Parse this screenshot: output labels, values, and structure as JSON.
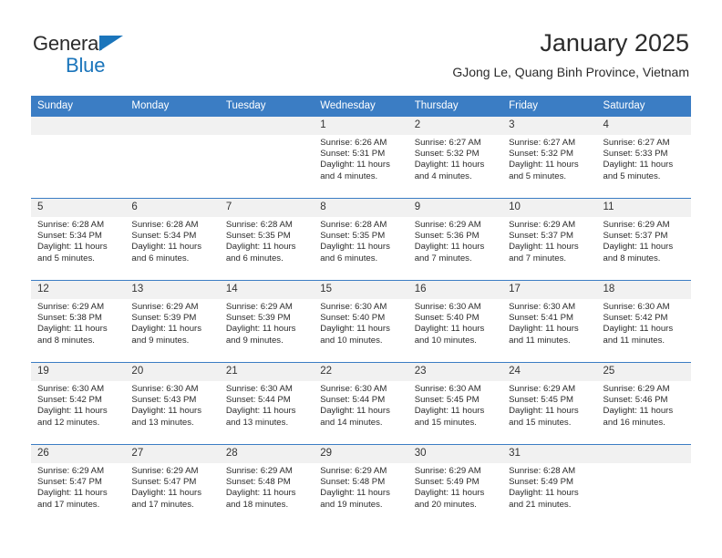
{
  "brand": {
    "name_top": "General",
    "name_bottom": "Blue",
    "triangle_color": "#1b75bb"
  },
  "header": {
    "title": "January 2025",
    "subtitle": "GJong Le, Quang Binh Province, Vietnam",
    "header_bg": "#3b7dc4",
    "daynum_bg": "#f1f1f1"
  },
  "weekdays": [
    "Sunday",
    "Monday",
    "Tuesday",
    "Wednesday",
    "Thursday",
    "Friday",
    "Saturday"
  ],
  "weeks": [
    [
      {
        "day": "",
        "lines": []
      },
      {
        "day": "",
        "lines": []
      },
      {
        "day": "",
        "lines": []
      },
      {
        "day": "1",
        "lines": [
          "Sunrise: 6:26 AM",
          "Sunset: 5:31 PM",
          "Daylight: 11 hours",
          "and 4 minutes."
        ]
      },
      {
        "day": "2",
        "lines": [
          "Sunrise: 6:27 AM",
          "Sunset: 5:32 PM",
          "Daylight: 11 hours",
          "and 4 minutes."
        ]
      },
      {
        "day": "3",
        "lines": [
          "Sunrise: 6:27 AM",
          "Sunset: 5:32 PM",
          "Daylight: 11 hours",
          "and 5 minutes."
        ]
      },
      {
        "day": "4",
        "lines": [
          "Sunrise: 6:27 AM",
          "Sunset: 5:33 PM",
          "Daylight: 11 hours",
          "and 5 minutes."
        ]
      }
    ],
    [
      {
        "day": "5",
        "lines": [
          "Sunrise: 6:28 AM",
          "Sunset: 5:34 PM",
          "Daylight: 11 hours",
          "and 5 minutes."
        ]
      },
      {
        "day": "6",
        "lines": [
          "Sunrise: 6:28 AM",
          "Sunset: 5:34 PM",
          "Daylight: 11 hours",
          "and 6 minutes."
        ]
      },
      {
        "day": "7",
        "lines": [
          "Sunrise: 6:28 AM",
          "Sunset: 5:35 PM",
          "Daylight: 11 hours",
          "and 6 minutes."
        ]
      },
      {
        "day": "8",
        "lines": [
          "Sunrise: 6:28 AM",
          "Sunset: 5:35 PM",
          "Daylight: 11 hours",
          "and 6 minutes."
        ]
      },
      {
        "day": "9",
        "lines": [
          "Sunrise: 6:29 AM",
          "Sunset: 5:36 PM",
          "Daylight: 11 hours",
          "and 7 minutes."
        ]
      },
      {
        "day": "10",
        "lines": [
          "Sunrise: 6:29 AM",
          "Sunset: 5:37 PM",
          "Daylight: 11 hours",
          "and 7 minutes."
        ]
      },
      {
        "day": "11",
        "lines": [
          "Sunrise: 6:29 AM",
          "Sunset: 5:37 PM",
          "Daylight: 11 hours",
          "and 8 minutes."
        ]
      }
    ],
    [
      {
        "day": "12",
        "lines": [
          "Sunrise: 6:29 AM",
          "Sunset: 5:38 PM",
          "Daylight: 11 hours",
          "and 8 minutes."
        ]
      },
      {
        "day": "13",
        "lines": [
          "Sunrise: 6:29 AM",
          "Sunset: 5:39 PM",
          "Daylight: 11 hours",
          "and 9 minutes."
        ]
      },
      {
        "day": "14",
        "lines": [
          "Sunrise: 6:29 AM",
          "Sunset: 5:39 PM",
          "Daylight: 11 hours",
          "and 9 minutes."
        ]
      },
      {
        "day": "15",
        "lines": [
          "Sunrise: 6:30 AM",
          "Sunset: 5:40 PM",
          "Daylight: 11 hours",
          "and 10 minutes."
        ]
      },
      {
        "day": "16",
        "lines": [
          "Sunrise: 6:30 AM",
          "Sunset: 5:40 PM",
          "Daylight: 11 hours",
          "and 10 minutes."
        ]
      },
      {
        "day": "17",
        "lines": [
          "Sunrise: 6:30 AM",
          "Sunset: 5:41 PM",
          "Daylight: 11 hours",
          "and 11 minutes."
        ]
      },
      {
        "day": "18",
        "lines": [
          "Sunrise: 6:30 AM",
          "Sunset: 5:42 PM",
          "Daylight: 11 hours",
          "and 11 minutes."
        ]
      }
    ],
    [
      {
        "day": "19",
        "lines": [
          "Sunrise: 6:30 AM",
          "Sunset: 5:42 PM",
          "Daylight: 11 hours",
          "and 12 minutes."
        ]
      },
      {
        "day": "20",
        "lines": [
          "Sunrise: 6:30 AM",
          "Sunset: 5:43 PM",
          "Daylight: 11 hours",
          "and 13 minutes."
        ]
      },
      {
        "day": "21",
        "lines": [
          "Sunrise: 6:30 AM",
          "Sunset: 5:44 PM",
          "Daylight: 11 hours",
          "and 13 minutes."
        ]
      },
      {
        "day": "22",
        "lines": [
          "Sunrise: 6:30 AM",
          "Sunset: 5:44 PM",
          "Daylight: 11 hours",
          "and 14 minutes."
        ]
      },
      {
        "day": "23",
        "lines": [
          "Sunrise: 6:30 AM",
          "Sunset: 5:45 PM",
          "Daylight: 11 hours",
          "and 15 minutes."
        ]
      },
      {
        "day": "24",
        "lines": [
          "Sunrise: 6:29 AM",
          "Sunset: 5:45 PM",
          "Daylight: 11 hours",
          "and 15 minutes."
        ]
      },
      {
        "day": "25",
        "lines": [
          "Sunrise: 6:29 AM",
          "Sunset: 5:46 PM",
          "Daylight: 11 hours",
          "and 16 minutes."
        ]
      }
    ],
    [
      {
        "day": "26",
        "lines": [
          "Sunrise: 6:29 AM",
          "Sunset: 5:47 PM",
          "Daylight: 11 hours",
          "and 17 minutes."
        ]
      },
      {
        "day": "27",
        "lines": [
          "Sunrise: 6:29 AM",
          "Sunset: 5:47 PM",
          "Daylight: 11 hours",
          "and 17 minutes."
        ]
      },
      {
        "day": "28",
        "lines": [
          "Sunrise: 6:29 AM",
          "Sunset: 5:48 PM",
          "Daylight: 11 hours",
          "and 18 minutes."
        ]
      },
      {
        "day": "29",
        "lines": [
          "Sunrise: 6:29 AM",
          "Sunset: 5:48 PM",
          "Daylight: 11 hours",
          "and 19 minutes."
        ]
      },
      {
        "day": "30",
        "lines": [
          "Sunrise: 6:29 AM",
          "Sunset: 5:49 PM",
          "Daylight: 11 hours",
          "and 20 minutes."
        ]
      },
      {
        "day": "31",
        "lines": [
          "Sunrise: 6:28 AM",
          "Sunset: 5:49 PM",
          "Daylight: 11 hours",
          "and 21 minutes."
        ]
      },
      {
        "day": "",
        "lines": []
      }
    ]
  ]
}
